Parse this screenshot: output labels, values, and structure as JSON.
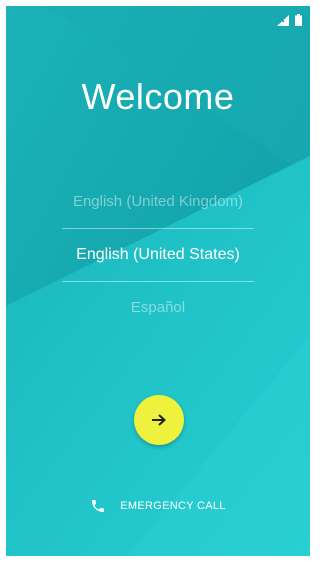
{
  "title": "Welcome",
  "languages": [
    {
      "label": "English (United Kingdom)",
      "selected": false
    },
    {
      "label": "English (United States)",
      "selected": true
    },
    {
      "label": "Español",
      "selected": false
    }
  ],
  "next_button": {
    "icon": "arrow-right-icon"
  },
  "emergency": {
    "label": "EMERGENCY CALL",
    "icon": "phone-icon"
  },
  "status_bar": {
    "icons": [
      "no-signal-icon",
      "battery-icon"
    ]
  },
  "colors": {
    "background": "#14a7ad",
    "background_light": "#2ecbd0",
    "next_button": "#eef23c",
    "text": "#ffffff"
  }
}
